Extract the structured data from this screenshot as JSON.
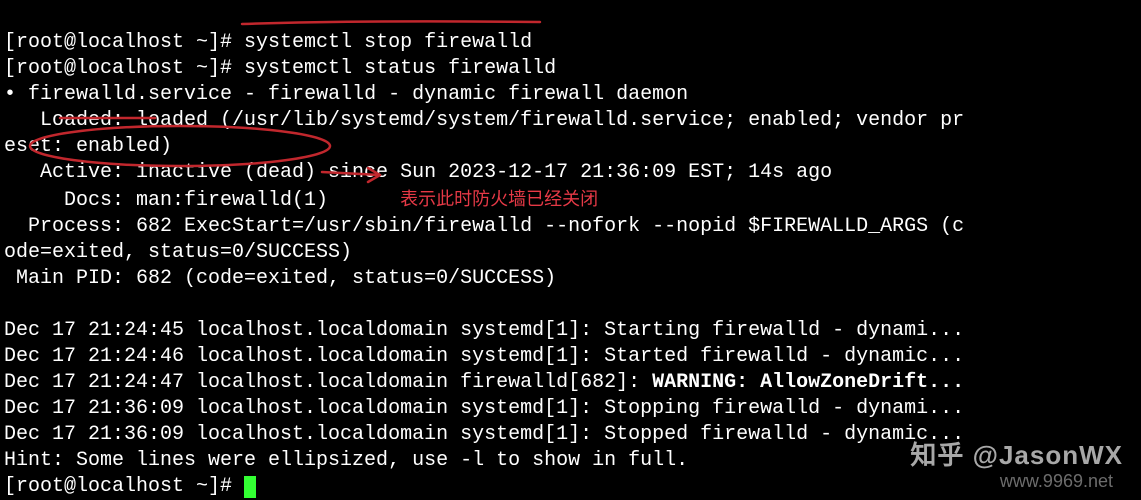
{
  "prompt": {
    "prefix": "[root@localhost ~]# "
  },
  "commands": {
    "cmd1": "systemctl stop firewalld",
    "cmd2": "systemctl status firewalld"
  },
  "status": {
    "bullet": "•",
    "unit_line": " firewalld.service - firewalld - dynamic firewall daemon",
    "loaded_line1": "   Loaded: loaded (/usr/lib/systemd/system/firewalld.service; enabled; vendor pr",
    "loaded_line2": "eset: enabled)",
    "active_line": "   Active: inactive (dead) since Sun 2023-12-17 21:36:09 EST; 14s ago",
    "docs_line": "     Docs: man:firewalld(1)",
    "process_line1": "  Process: 682 ExecStart=/usr/sbin/firewalld --nofork --nopid $FIREWALLD_ARGS (c",
    "process_line2": "ode=exited, status=0/SUCCESS)",
    "mainpid_line": " Main PID: 682 (code=exited, status=0/SUCCESS)"
  },
  "annotation": {
    "text": "表示此时防火墙已经关闭"
  },
  "journal": {
    "l1_prefix": "Dec 17 21:24:45 localhost.localdomain systemd[1]: Starting firewalld - dynami.",
    "l1_dots": "..",
    "l2": "Dec 17 21:24:46 localhost.localdomain systemd[1]: Started firewalld - dynamic...",
    "l3_prefix": "Dec 17 21:24:47 localhost.localdomain firewalld[682]: ",
    "l3_bold": "WARNING: AllowZoneDrift...",
    "l4": "Dec 17 21:36:09 localhost.localdomain systemd[1]: Stopping firewalld - dynami...",
    "l5": "Dec 17 21:36:09 localhost.localdomain systemd[1]: Stopped firewalld - dynamic...",
    "hint": "Hint: Some lines were ellipsized, use -l to show in full."
  },
  "watermark": {
    "zhihu": "知乎 @JasonWX",
    "url": "www.9969.net"
  }
}
